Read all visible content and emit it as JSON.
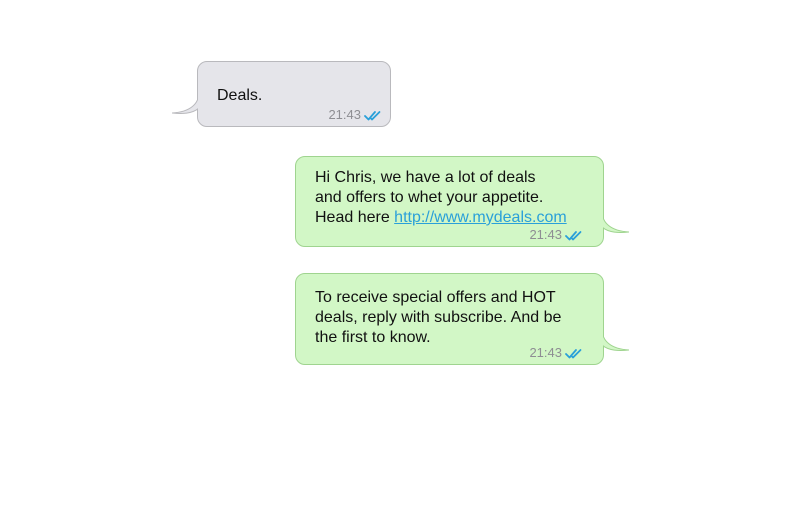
{
  "messages": [
    {
      "direction": "incoming",
      "text": "Deals.",
      "time": "21:43",
      "status_icon": "double-check-icon"
    },
    {
      "direction": "outgoing",
      "text": "Hi Chris, we have a lot of deals\nand offers to whet your appetite.\nHead here ",
      "link": "http://www.mydeals.com",
      "time": "21:43",
      "status_icon": "double-check-icon"
    },
    {
      "direction": "outgoing",
      "text": "To receive special offers and HOT\ndeals, reply with subscribe. And be\nthe first to know.",
      "time": "21:43",
      "status_icon": "double-check-icon"
    }
  ],
  "colors": {
    "incoming_bubble": "#e5e5ea",
    "outgoing_bubble": "#d2f7c6",
    "link": "#2aa0d9",
    "read_check": "#2aa0d9",
    "timestamp": "#8e8e93"
  }
}
